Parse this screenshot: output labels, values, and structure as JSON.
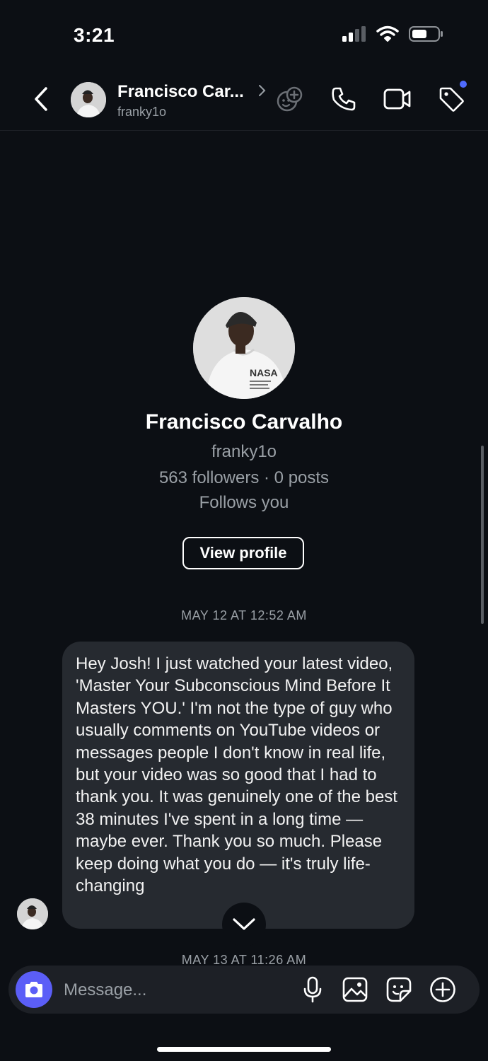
{
  "status_bar": {
    "time": "3:21"
  },
  "header": {
    "name": "Francisco Car...",
    "username": "franky1o"
  },
  "profile": {
    "name": "Francisco Carvalho",
    "username": "franky1o",
    "stats": "563 followers · 0 posts",
    "relation": "Follows you",
    "view_profile_label": "View profile"
  },
  "messages": [
    {
      "timestamp": "MAY 12 AT 12:52 AM",
      "text": "Hey Josh! I just watched your latest video, 'Master Your Subconscious Mind Before It Masters YOU.' I'm not the type of guy who usually comments on YouTube videos or messages people I don't know in real life, but your video was so good that I had to thank you. It was genuinely one of the best 38 minutes I've spent in a long time — maybe ever. Thank you so much. Please keep doing what you do — it's truly life-changing"
    },
    {
      "timestamp": "MAY 13 AT 11:26 AM"
    }
  ],
  "composer": {
    "placeholder": "Message..."
  },
  "colors": {
    "accent": "#5b5ef7",
    "badge": "#4f6bff",
    "bubble": "#262a30",
    "background": "#0c0f14"
  },
  "icons": [
    "back-icon",
    "effects-icon",
    "phone-icon",
    "video-icon",
    "tag-icon",
    "chevron-down-icon",
    "camera-icon",
    "microphone-icon",
    "gallery-icon",
    "sticker-icon",
    "plus-icon"
  ]
}
